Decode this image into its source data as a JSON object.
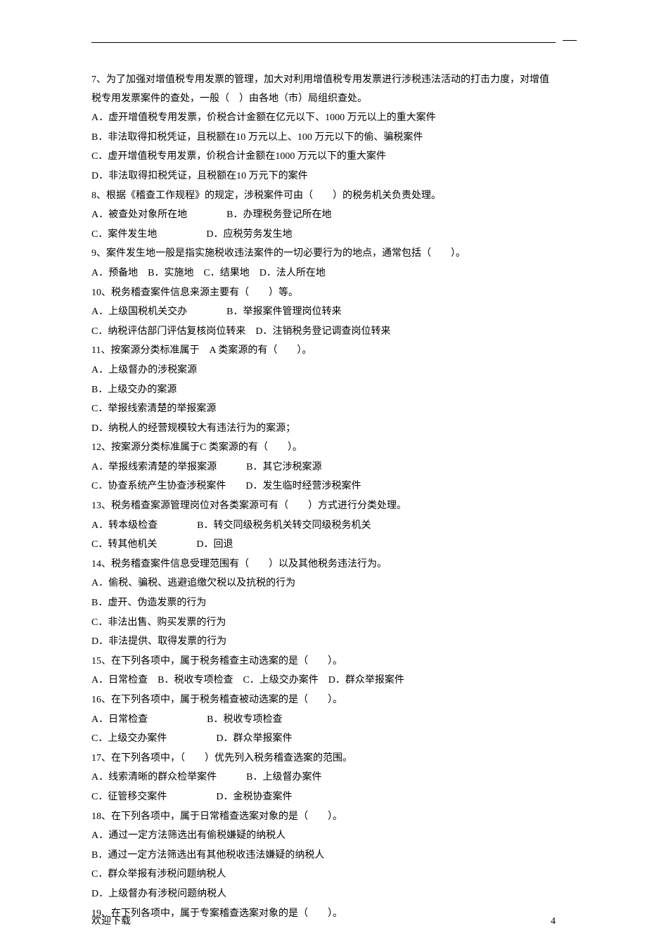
{
  "questions": [
    {
      "stem": "7、为了加强对增值税专用发票的管理，加大对利用增值税专用发票进行涉税违法活动的打击力度，对增值税专用发票案件的查处，一般（　）由各地（市）局组织查处。",
      "opts": [
        "A．虚开增值税专用发票，价税合计金额在亿元以下、1000 万元以上的重大案件",
        "B．非法取得扣税凭证，且税额在10 万元以上、100 万元以下的偷、骗税案件",
        "C．虚开增值税专用发票，价税合计金额在1000 万元以下的重大案件",
        "D．非法取得扣税凭证，且税额在10 万元下的案件"
      ]
    },
    {
      "stem": "8、根据《稽查工作规程》的规定，涉税案件可由（　　）的税务机关负责处理。",
      "opts": [
        "A．被查处对象所在地　　　　B．办理税务登记所在地",
        "C．案件发生地　　　　　D．应税劳务发生地"
      ]
    },
    {
      "stem": "9、案件发生地一般是指实施税收违法案件的一切必要行为的地点，通常包括（　　）。",
      "opts": [
        "A．预备地　B．实施地　C．结果地　D．法人所在地"
      ]
    },
    {
      "stem": "10、税务稽查案件信息来源主要有（　　）等。",
      "opts": [
        "A．上级国税机关交办　　　　B．举报案件管理岗位转来",
        "C．纳税评估部门评估复核岗位转来　D．注销税务登记调查岗位转来"
      ]
    },
    {
      "stem": "11、按案源分类标准属于　A 类案源的有（　　）。",
      "opts": [
        "A．上级督办的涉税案源",
        "B．上级交办的案源",
        "C．举报线索清楚的举报案源",
        "D．纳税人的经营规模较大有违法行为的案源；"
      ]
    },
    {
      "stem": "12、按案源分类标准属于C 类案源的有（　　）。",
      "opts": [
        "A．举报线索清楚的举报案源　　　B．其它涉税案源",
        "C．协查系统产生协查涉税案件　　D．发生临时经营涉税案件"
      ]
    },
    {
      "stem": "13、税务稽查案源管理岗位对各类案源可有（　　）方式进行分类处理。",
      "opts": [
        "A．转本级检查　　　　B．转交同级税务机关转交同级税务机关",
        "C．转其他机关　　　　D．回退"
      ]
    },
    {
      "stem": "14、税务稽查案件信息受理范围有（　　）以及其他税务违法行为。",
      "opts": [
        "A．偷税、骗税、逃避追缴欠税以及抗税的行为",
        "B．虚开、伪造发票的行为",
        "C．非法出售、购买发票的行为",
        "D．非法提供、取得发票的行为"
      ]
    },
    {
      "stem": "15、在下列各项中，属于税务稽查主动选案的是（　　）。",
      "opts": [
        "A．日常检查　B．税收专项检查　C．上级交办案件　D．群众举报案件"
      ]
    },
    {
      "stem": "16、在下列各项中，属于税务稽查被动选案的是（　　）。",
      "opts": [
        "A．日常检查　　　　　　B．税收专项检查",
        "C．上级交办案件　　　　　D．群众举报案件"
      ]
    },
    {
      "stem": "17、在下列各项中，（　　）优先列入税务稽查选案的范围。",
      "opts": [
        "A．线索清晰的群众检举案件　　　B．上级督办案件",
        "C．征管移交案件　　　　　D．金税协查案件"
      ]
    },
    {
      "stem": "18、在下列各项中，属于日常稽查选案对象的是（　　）。",
      "opts": [
        "A．通过一定方法筛选出有偷税嫌疑的纳税人",
        "B．通过一定方法筛选出有其他税收违法嫌疑的纳税人",
        "C．群众举报有涉税问题纳税人",
        "D．上级督办有涉税问题纳税人"
      ]
    },
    {
      "stem": "19、在下列各项中，属于专案稽查选案对象的是（　　）。",
      "opts": []
    }
  ],
  "footer_left": "欢迎下载",
  "footer_right": "4"
}
